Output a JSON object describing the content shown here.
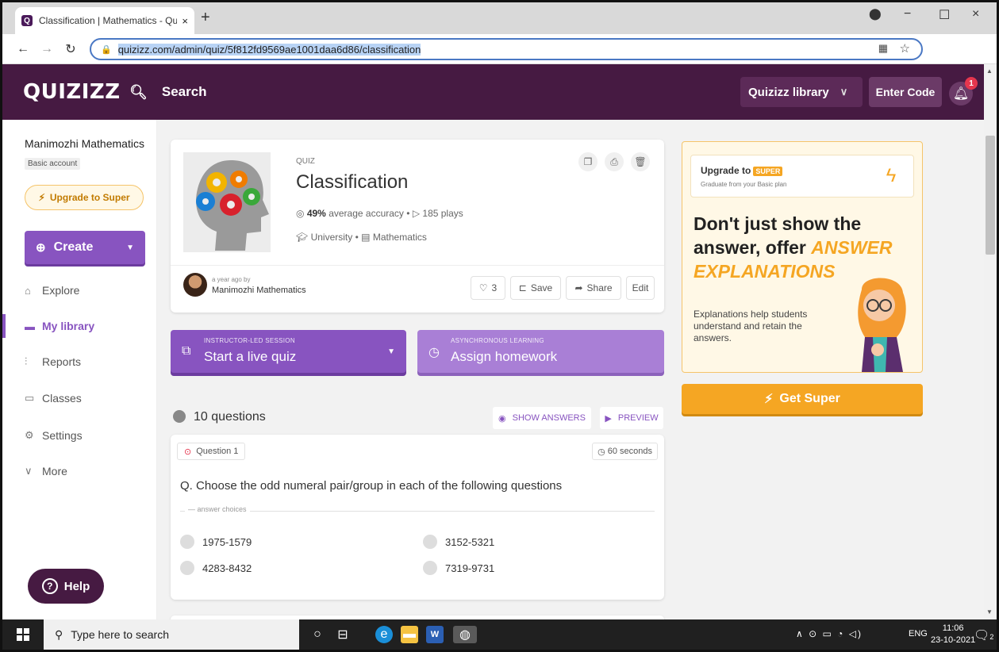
{
  "browser": {
    "tab_title": "Classification | Mathematics - Qu",
    "tab_close": "×",
    "new_tab": "+",
    "url": "quizizz.com/admin/quiz/5f812fd9569ae1001daa6d86/classification",
    "minimize": "−",
    "maximize": "☐",
    "close": "×"
  },
  "header": {
    "logo": "QUIZIZZ",
    "search_placeholder": "Search",
    "library_select": "Quizizz library",
    "enter_code": "Enter Code",
    "notification_count": "1"
  },
  "sidebar": {
    "user_name": "Manimozhi Mathematics",
    "account_type": "Basic account",
    "upgrade_label": "Upgrade to Super",
    "create_label": "Create",
    "items": [
      {
        "label": "Explore",
        "icon": "explore-icon"
      },
      {
        "label": "My library",
        "icon": "folder-icon"
      },
      {
        "label": "Reports",
        "icon": "reports-icon"
      },
      {
        "label": "Classes",
        "icon": "classes-icon"
      },
      {
        "label": "Settings",
        "icon": "settings-icon"
      },
      {
        "label": "More",
        "icon": "chevron-down-icon"
      }
    ],
    "help_label": "Help"
  },
  "quiz": {
    "type": "QUIZ",
    "title": "Classification",
    "accuracy": "49%",
    "accuracy_text": "average accuracy",
    "plays": "185 plays",
    "level": "University",
    "subject": "Mathematics",
    "author_time": "a year ago by",
    "author": "Manimozhi Mathematics",
    "likes": "3",
    "save_label": "Save",
    "share_label": "Share",
    "edit_label": "Edit"
  },
  "session": {
    "live_small": "INSTRUCTOR-LED SESSION",
    "live_label": "Start a live quiz",
    "hw_small": "ASYNCHRONOUS LEARNING",
    "hw_label": "Assign homework"
  },
  "questions": {
    "count_label": "10 questions",
    "show_answers": "SHOW ANSWERS",
    "preview": "PREVIEW",
    "items": [
      {
        "number": "Question 1",
        "time": "60 seconds",
        "text": "Q. Choose the odd numeral pair/group in each of the following questions",
        "answer_label": "answer choices",
        "choices": [
          "1975-1579",
          "3152-5321",
          "4283-8432",
          "7319-9731"
        ]
      }
    ]
  },
  "upgrade": {
    "title": "Upgrade to",
    "super_badge": "SUPER",
    "subtitle": "Graduate from your Basic plan",
    "headline_1": "Don't just show the answer, offer ",
    "headline_hl": "ANSWER EXPLANATIONS",
    "description": "Explanations help students understand and retain the answers.",
    "cta": "Get Super"
  },
  "taskbar": {
    "search_placeholder": "Type here to search",
    "language": "ENG",
    "time": "11:06",
    "date": "23-10-2021",
    "notifications": "2"
  },
  "colors": {
    "brand_dark": "#461a42",
    "purple": "#8854c0",
    "orange": "#f5a623"
  }
}
